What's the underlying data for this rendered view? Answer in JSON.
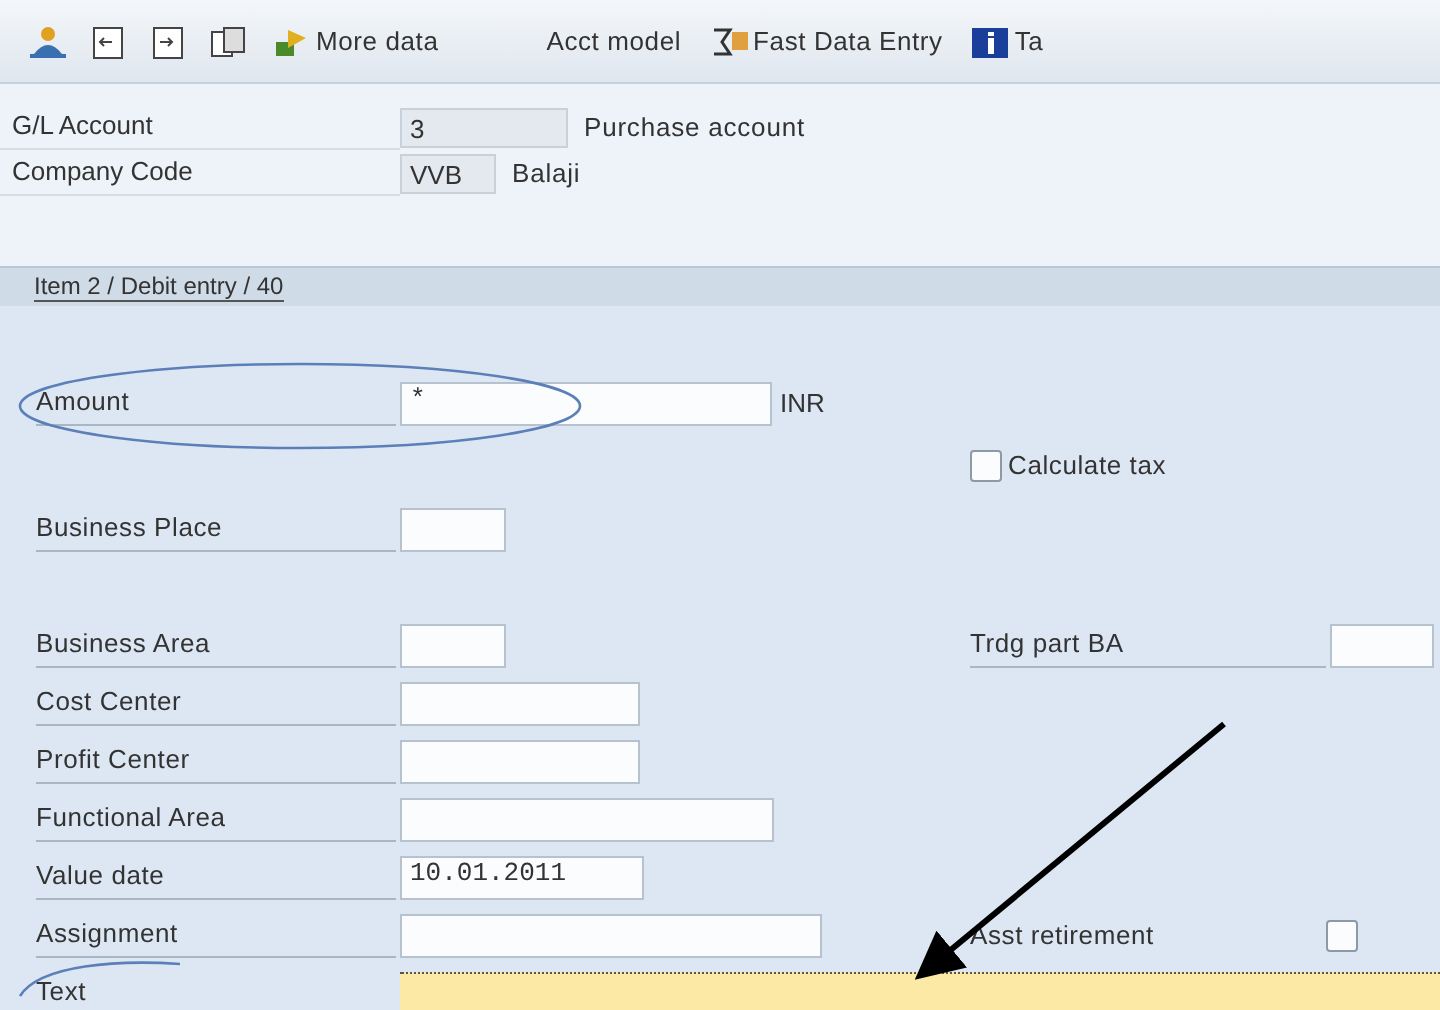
{
  "toolbar": [
    {
      "kind": "icon"
    },
    {
      "kind": "icon"
    },
    {
      "kind": "icon"
    },
    {
      "kind": "icon"
    },
    {
      "kind": "button",
      "label": "More data"
    },
    {
      "kind": "button",
      "label": "Acct model"
    },
    {
      "kind": "button",
      "label": "Fast Data Entry"
    },
    {
      "kind": "button",
      "label": "Ta"
    }
  ],
  "header": [
    {
      "label": "G/L Account",
      "value": "3",
      "description": "Purchase account"
    },
    {
      "label": "Company Code",
      "value": "VVB",
      "description": "Balaji"
    }
  ],
  "section_title": "Item 2 / Debit entry / 40",
  "rows": [
    {
      "kind": "field",
      "label": "Amount",
      "value": "*",
      "unit": "INR",
      "focused": false
    },
    {
      "kind": "checkbox",
      "label": "Calculate tax",
      "checked": false
    },
    {
      "kind": "field",
      "label": "Business Place",
      "focused": false
    },
    {
      "kind": "field",
      "label": "Business Area",
      "focused": false,
      "right": {
        "kind": "field",
        "label": "Trdg part BA"
      }
    },
    {
      "kind": "field",
      "label": "Cost Center",
      "focused": false
    },
    {
      "kind": "field",
      "label": "Profit Center",
      "focused": false
    },
    {
      "kind": "field",
      "label": "Functional Area",
      "focused": false
    },
    {
      "kind": "field",
      "label": "Value date",
      "value": "10.01.2011",
      "focused": false
    },
    {
      "kind": "field",
      "label": "Assignment",
      "focused": false,
      "right": {
        "kind": "checkbox",
        "label": "Asst retirement",
        "checked": false
      }
    },
    {
      "kind": "field",
      "label": "Text",
      "focused": true
    }
  ]
}
